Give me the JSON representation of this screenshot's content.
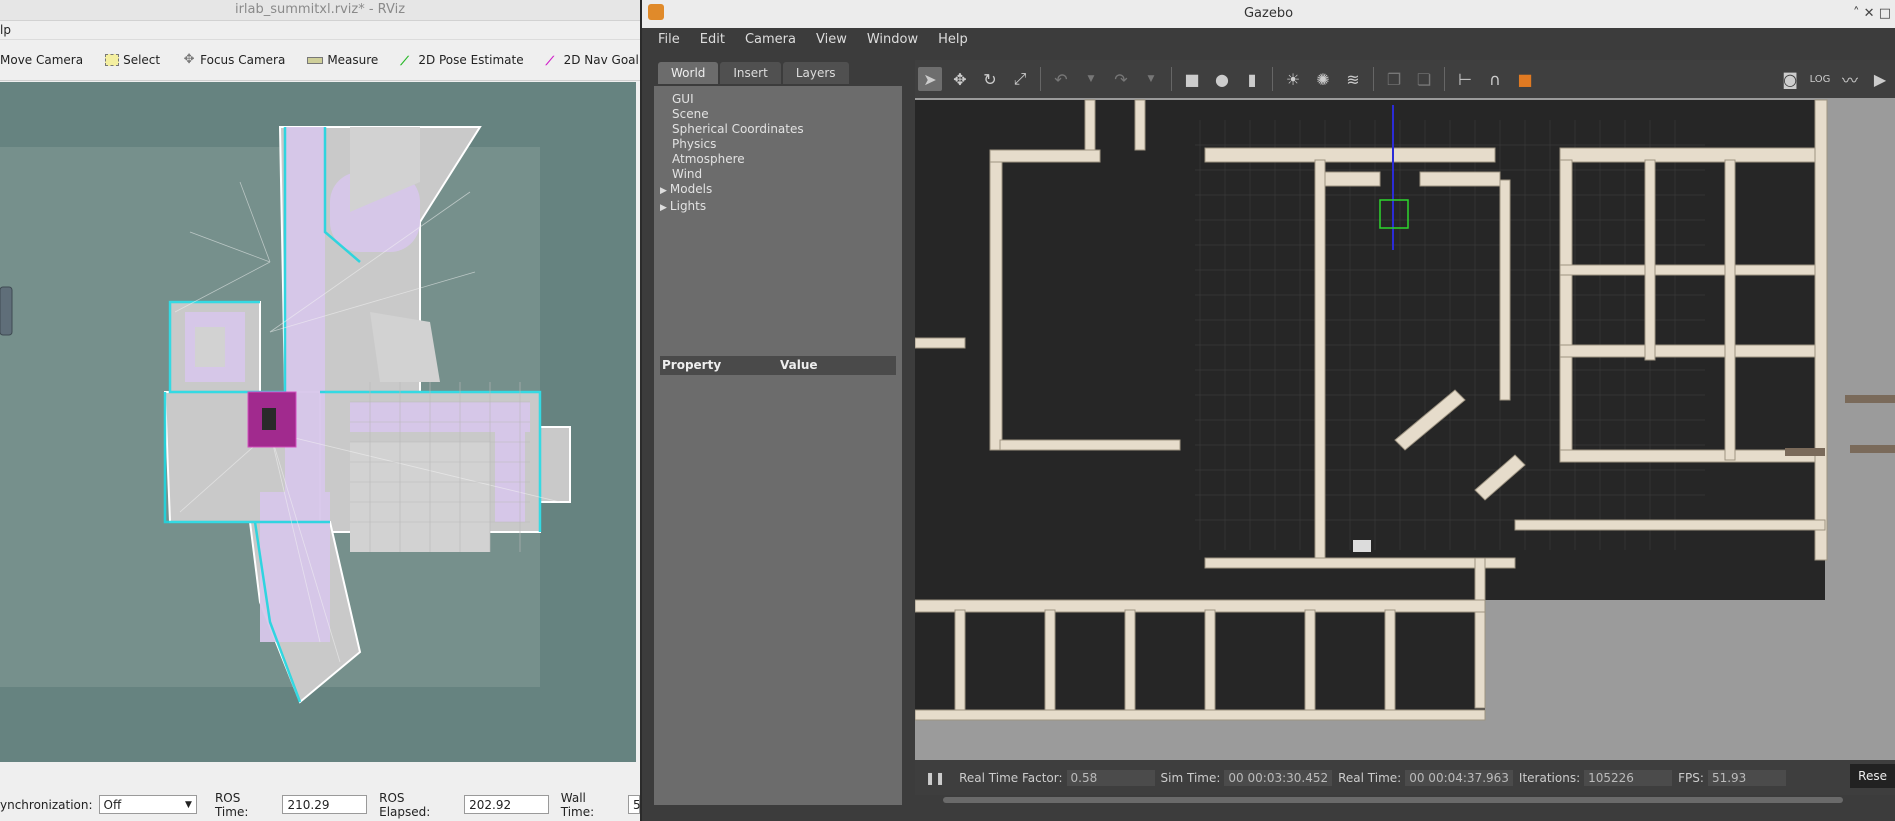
{
  "rviz": {
    "title": "irlab_summitxl.rviz* - RViz",
    "menu_fragment": "lp",
    "tools": [
      "Move Camera",
      "Select",
      "Focus Camera",
      "Measure",
      "2D Pose Estimate",
      "2D Nav Goal"
    ],
    "status": {
      "sync_label": "ynchronization:",
      "sync_value": "Off",
      "ros_time_label": "ROS Time:",
      "ros_time": "210.29",
      "ros_elapsed_label": "ROS Elapsed:",
      "ros_elapsed": "202.92",
      "wall_time_label": "Wall Time:",
      "wall_time_fragment": "5"
    }
  },
  "gazebo": {
    "title": "Gazebo",
    "menu": [
      "File",
      "Edit",
      "Camera",
      "View",
      "Window",
      "Help"
    ],
    "tabs": [
      "World",
      "Insert",
      "Layers"
    ],
    "world_tree": [
      {
        "label": "GUI",
        "branch": false
      },
      {
        "label": "Scene",
        "branch": false
      },
      {
        "label": "Spherical Coordinates",
        "branch": false
      },
      {
        "label": "Physics",
        "branch": false
      },
      {
        "label": "Atmosphere",
        "branch": false
      },
      {
        "label": "Wind",
        "branch": false
      },
      {
        "label": "Models",
        "branch": true
      },
      {
        "label": "Lights",
        "branch": true
      }
    ],
    "property_header": {
      "property": "Property",
      "value": "Value"
    },
    "bottom": {
      "rtf_label": "Real Time Factor:",
      "rtf": "0.58",
      "sim_label": "Sim Time:",
      "sim_time": "00 00:03:30.452",
      "real_label": "Real Time:",
      "real_time": "00 00:04:37.963",
      "iter_label": "Iterations:",
      "iterations": "105226",
      "fps_label": "FPS:",
      "fps": "51.93",
      "reset_label": "Rese"
    },
    "window_controls": "˄ ✕ □"
  },
  "colors": {
    "rviz_bg": "#668380",
    "gazebo_dark": "#3c3c3c",
    "wall": "#e6dccb",
    "floor": "#232323"
  }
}
